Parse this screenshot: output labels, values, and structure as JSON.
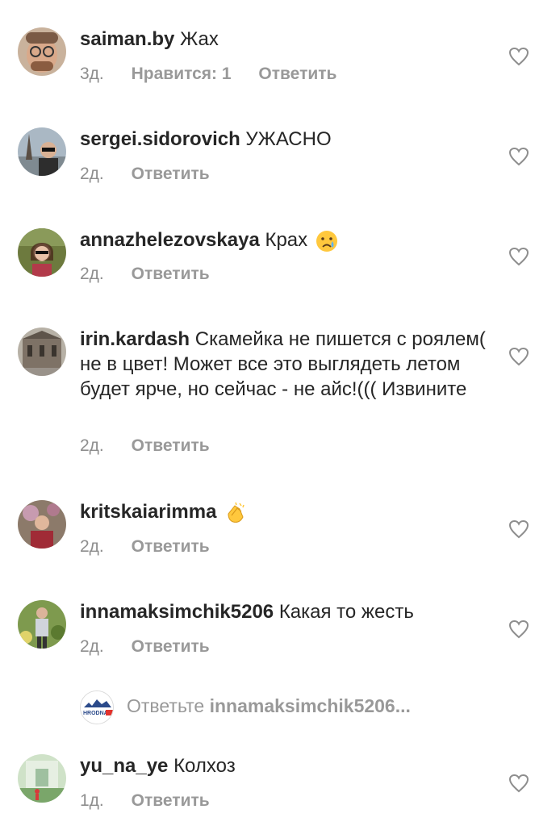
{
  "comments": [
    {
      "username": "saiman.by",
      "text": "Жах",
      "time": "3д.",
      "likes": "Нравится: 1",
      "reply_label": "Ответить",
      "avatar_icon": "avatar-man-glasses"
    },
    {
      "username": "sergei.sidorovich",
      "text": "УЖАСНО",
      "time": "2д.",
      "reply_label": "Ответить",
      "avatar_icon": "avatar-man-eiffel"
    },
    {
      "username": "annazhelezovskaya",
      "text": "Крах",
      "emoji": "crying-face-emoji",
      "time": "2д.",
      "reply_label": "Ответить",
      "avatar_icon": "avatar-woman-sunglasses"
    },
    {
      "username": "irin.kardash",
      "text": "Скамейка не пишется с роялем( не в цвет! Может все это выглядеть летом будет ярче, но сейчас - не айс!((( Извините",
      "time": "2д.",
      "reply_label": "Ответить",
      "avatar_icon": "avatar-building"
    },
    {
      "username": "kritskaiarimma",
      "text": "",
      "emoji": "clapping-hands-emoji",
      "time": "2д.",
      "reply_label": "Ответить",
      "avatar_icon": "avatar-woman-flowers"
    },
    {
      "username": "innamaksimchik5206",
      "text": "Какая то жесть",
      "time": "2д.",
      "reply_label": "Ответить",
      "avatar_icon": "avatar-man-garden"
    },
    {
      "username": "yu_na_ye",
      "text": "Колхоз",
      "time": "1д.",
      "reply_label": "Ответить",
      "avatar_icon": "avatar-park"
    }
  ],
  "reply_prompt": {
    "prefix": "Ответьте",
    "username": "innamaksimchik5206...",
    "logo_text": "HRODNA"
  },
  "colors": {
    "text": "#262626",
    "meta": "#8e8e8e",
    "background": "#ffffff"
  }
}
